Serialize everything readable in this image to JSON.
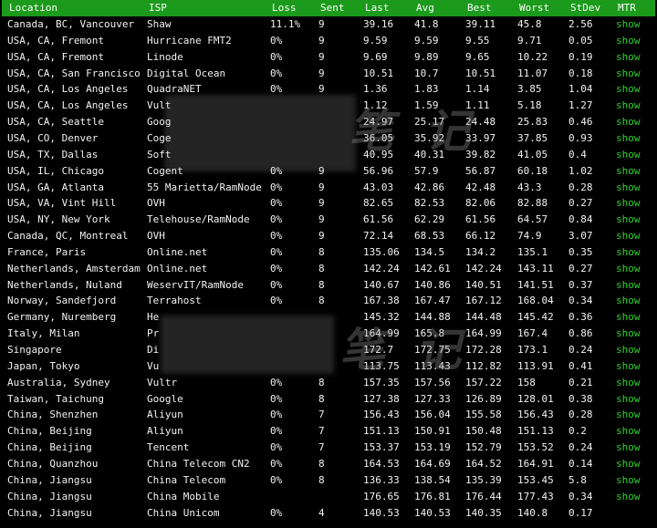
{
  "columns": {
    "location": "Location",
    "isp": "ISP",
    "loss": "Loss",
    "sent": "Sent",
    "last": "Last",
    "avg": "Avg",
    "best": "Best",
    "worst": "Worst",
    "stdev": "StDev",
    "mtr": "MTR"
  },
  "colors": {
    "header_bg": "#1b9a1b",
    "link": "#2fd12f",
    "text": "#f2f2f2",
    "background": "#000000"
  },
  "rows": [
    {
      "location": "Canada, BC, Vancouver",
      "isp": "Shaw",
      "loss": "11.1%",
      "sent": "9",
      "last": "39.16",
      "avg": "41.8",
      "best": "39.11",
      "worst": "45.8",
      "stdev": "2.56",
      "mtr": "show"
    },
    {
      "location": "USA, CA, Fremont",
      "isp": "Hurricane FMT2",
      "loss": "0%",
      "sent": "9",
      "last": "9.59",
      "avg": "9.59",
      "best": "9.55",
      "worst": "9.71",
      "stdev": "0.05",
      "mtr": "show"
    },
    {
      "location": "USA, CA, Fremont",
      "isp": "Linode",
      "loss": "0%",
      "sent": "9",
      "last": "9.69",
      "avg": "9.89",
      "best": "9.65",
      "worst": "10.22",
      "stdev": "0.19",
      "mtr": "show"
    },
    {
      "location": "USA, CA, San Francisco",
      "isp": "Digital Ocean",
      "loss": "0%",
      "sent": "9",
      "last": "10.51",
      "avg": "10.7",
      "best": "10.51",
      "worst": "11.07",
      "stdev": "0.18",
      "mtr": "show"
    },
    {
      "location": "USA, CA, Los Angeles",
      "isp": "QuadraNET",
      "loss": "0%",
      "sent": "9",
      "last": "1.36",
      "avg": "1.83",
      "best": "1.14",
      "worst": "3.85",
      "stdev": "1.04",
      "mtr": "show"
    },
    {
      "location": "USA, CA, Los Angeles",
      "isp": "Vult",
      "loss": "",
      "sent": "",
      "last": "1.12",
      "avg": "1.59",
      "best": "1.11",
      "worst": "5.18",
      "stdev": "1.27",
      "mtr": "show"
    },
    {
      "location": "USA, CA, Seattle",
      "isp": "Goog",
      "loss": "",
      "sent": "",
      "last": "24.97",
      "avg": "25.17",
      "best": "24.48",
      "worst": "25.83",
      "stdev": "0.46",
      "mtr": "show"
    },
    {
      "location": "USA, CO, Denver",
      "isp": "Coge",
      "loss": "",
      "sent": "",
      "last": "36.05",
      "avg": "35.92",
      "best": "33.97",
      "worst": "37.85",
      "stdev": "0.93",
      "mtr": "show"
    },
    {
      "location": "USA, TX, Dallas",
      "isp": "Soft",
      "loss": "",
      "sent": "",
      "last": "40.95",
      "avg": "40.31",
      "best": "39.82",
      "worst": "41.05",
      "stdev": "0.4",
      "mtr": "show"
    },
    {
      "location": "USA, IL, Chicago",
      "isp": "Cogent",
      "loss": "0%",
      "sent": "9",
      "last": "56.96",
      "avg": "57.9",
      "best": "56.87",
      "worst": "60.18",
      "stdev": "1.02",
      "mtr": "show"
    },
    {
      "location": "USA, GA, Atlanta",
      "isp": "55 Marietta/RamNode",
      "loss": "0%",
      "sent": "9",
      "last": "43.03",
      "avg": "42.86",
      "best": "42.48",
      "worst": "43.3",
      "stdev": "0.28",
      "mtr": "show"
    },
    {
      "location": "USA, VA, Vint Hill",
      "isp": "OVH",
      "loss": "0%",
      "sent": "9",
      "last": "82.65",
      "avg": "82.53",
      "best": "82.06",
      "worst": "82.88",
      "stdev": "0.27",
      "mtr": "show"
    },
    {
      "location": "USA, NY, New York",
      "isp": "Telehouse/RamNode",
      "loss": "0%",
      "sent": "9",
      "last": "61.56",
      "avg": "62.29",
      "best": "61.56",
      "worst": "64.57",
      "stdev": "0.84",
      "mtr": "show"
    },
    {
      "location": "Canada, QC, Montreal",
      "isp": "OVH",
      "loss": "0%",
      "sent": "9",
      "last": "72.14",
      "avg": "68.53",
      "best": "66.12",
      "worst": "74.9",
      "stdev": "3.07",
      "mtr": "show"
    },
    {
      "location": "France, Paris",
      "isp": "Online.net",
      "loss": "0%",
      "sent": "8",
      "last": "135.06",
      "avg": "134.5",
      "best": "134.2",
      "worst": "135.1",
      "stdev": "0.35",
      "mtr": "show"
    },
    {
      "location": "Netherlands, Amsterdam",
      "isp": "Online.net",
      "loss": "0%",
      "sent": "8",
      "last": "142.24",
      "avg": "142.61",
      "best": "142.24",
      "worst": "143.11",
      "stdev": "0.27",
      "mtr": "show"
    },
    {
      "location": "Netherlands, Nuland",
      "isp": "WeservIT/RamNode",
      "loss": "0%",
      "sent": "8",
      "last": "140.67",
      "avg": "140.86",
      "best": "140.51",
      "worst": "141.51",
      "stdev": "0.37",
      "mtr": "show"
    },
    {
      "location": "Norway, Sandefjord",
      "isp": "Terrahost",
      "loss": "0%",
      "sent": "8",
      "last": "167.38",
      "avg": "167.47",
      "best": "167.12",
      "worst": "168.04",
      "stdev": "0.34",
      "mtr": "show"
    },
    {
      "location": "Germany, Nuremberg",
      "isp": "He",
      "loss": "",
      "sent": "",
      "last": "145.32",
      "avg": "144.88",
      "best": "144.48",
      "worst": "145.42",
      "stdev": "0.36",
      "mtr": "show"
    },
    {
      "location": "Italy, Milan",
      "isp": "Pr",
      "loss": "",
      "sent": "",
      "last": "164.99",
      "avg": "165.8",
      "best": "164.99",
      "worst": "167.4",
      "stdev": "0.86",
      "mtr": "show"
    },
    {
      "location": "Singapore",
      "isp": "Di",
      "loss": "",
      "sent": "",
      "last": "172.7",
      "avg": "172.75",
      "best": "172.28",
      "worst": "173.1",
      "stdev": "0.24",
      "mtr": "show"
    },
    {
      "location": "Japan, Tokyo",
      "isp": "Vu",
      "loss": "",
      "sent": "",
      "last": "113.75",
      "avg": "113.43",
      "best": "112.82",
      "worst": "113.91",
      "stdev": "0.41",
      "mtr": "show"
    },
    {
      "location": "Australia, Sydney",
      "isp": "Vultr",
      "loss": "0%",
      "sent": "8",
      "last": "157.35",
      "avg": "157.56",
      "best": "157.22",
      "worst": "158",
      "stdev": "0.21",
      "mtr": "show"
    },
    {
      "location": "Taiwan, Taichung",
      "isp": "Google",
      "loss": "0%",
      "sent": "8",
      "last": "127.38",
      "avg": "127.33",
      "best": "126.89",
      "worst": "128.01",
      "stdev": "0.38",
      "mtr": "show"
    },
    {
      "location": "China, Shenzhen",
      "isp": "Aliyun",
      "loss": "0%",
      "sent": "7",
      "last": "156.43",
      "avg": "156.04",
      "best": "155.58",
      "worst": "156.43",
      "stdev": "0.28",
      "mtr": "show"
    },
    {
      "location": "China, Beijing",
      "isp": "Aliyun",
      "loss": "0%",
      "sent": "7",
      "last": "151.13",
      "avg": "150.91",
      "best": "150.48",
      "worst": "151.13",
      "stdev": "0.2",
      "mtr": "show"
    },
    {
      "location": "China, Beijing",
      "isp": "Tencent",
      "loss": "0%",
      "sent": "7",
      "last": "153.37",
      "avg": "153.19",
      "best": "152.79",
      "worst": "153.52",
      "stdev": "0.24",
      "mtr": "show"
    },
    {
      "location": "China, Quanzhou",
      "isp": "China Telecom CN2",
      "loss": "0%",
      "sent": "8",
      "last": "164.53",
      "avg": "164.69",
      "best": "164.52",
      "worst": "164.91",
      "stdev": "0.14",
      "mtr": "show"
    },
    {
      "location": "China, Jiangsu",
      "isp": "China Telecom",
      "loss": "0%",
      "sent": "8",
      "last": "136.33",
      "avg": "138.54",
      "best": "135.39",
      "worst": "153.45",
      "stdev": "5.8",
      "mtr": "show"
    },
    {
      "location": "China, Jiangsu",
      "isp": "China Mobile",
      "loss": "",
      "sent": "",
      "last": "176.65",
      "avg": "176.81",
      "best": "176.44",
      "worst": "177.43",
      "stdev": "0.34",
      "mtr": "show"
    },
    {
      "location": "China, Jiangsu",
      "isp": "China Unicom",
      "loss": "0%",
      "sent": "4",
      "last": "140.53",
      "avg": "140.53",
      "best": "140.35",
      "worst": "140.8",
      "stdev": "0.17",
      "mtr": ""
    }
  ]
}
